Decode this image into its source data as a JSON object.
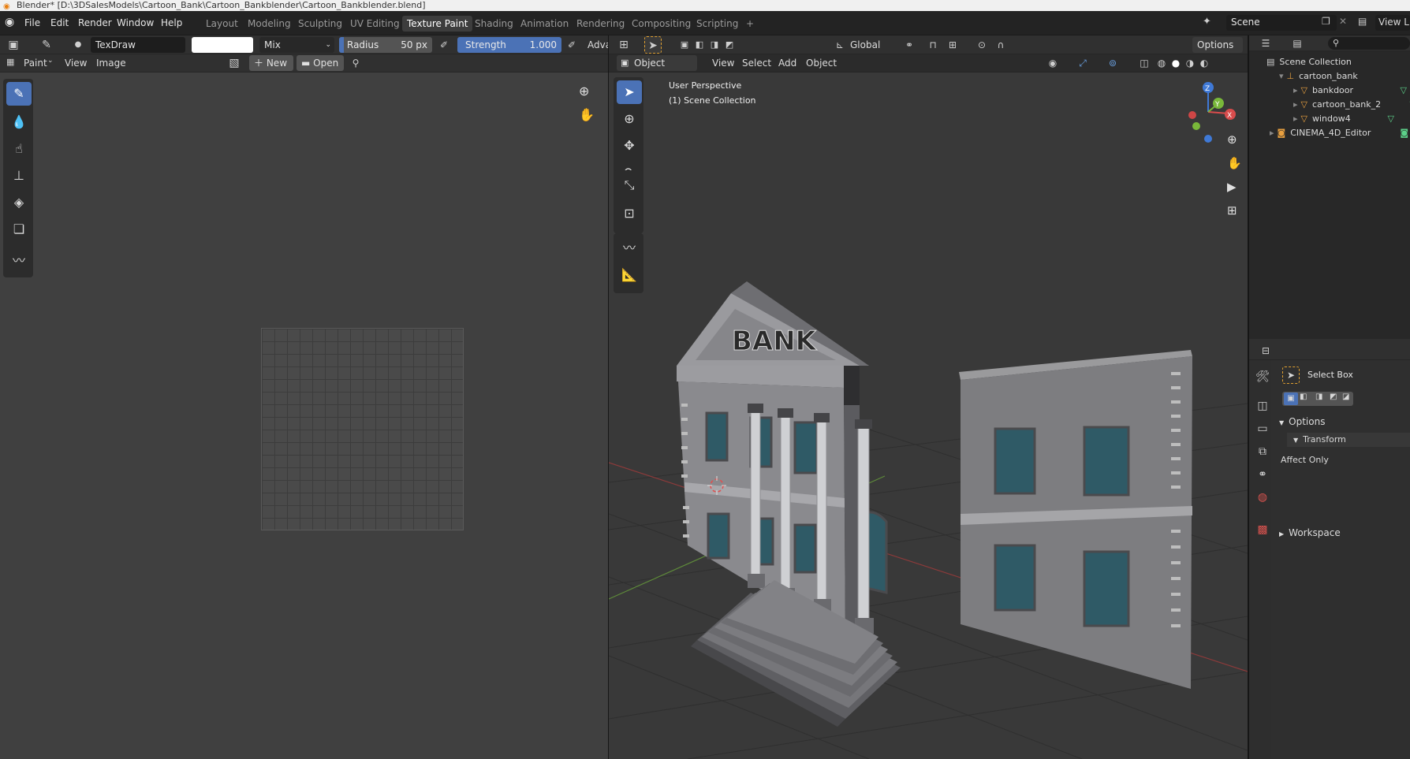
{
  "window_title": "Blender* [D:\\3DSalesModels\\Cartoon_Bank\\Cartoon_Bankblender\\Cartoon_Bankblender.blend]",
  "menu": [
    "File",
    "Edit",
    "Render",
    "Window",
    "Help"
  ],
  "workspaces": [
    "Layout",
    "Modeling",
    "Sculpting",
    "UV Editing",
    "Texture Paint",
    "Shading",
    "Animation",
    "Rendering",
    "Compositing",
    "Scripting"
  ],
  "active_workspace": "Texture Paint",
  "add_workspace": "+",
  "scene": "Scene",
  "view_layer": "View L",
  "image_editor": {
    "brush_name": "TexDraw",
    "blend_mode": "Mix",
    "radius_label": "Radius",
    "radius_value": "50 px",
    "strength_label": "Strength",
    "strength_value": "1.000",
    "advanced": "Adva",
    "mode": "Paint",
    "menus": [
      "View",
      "Image"
    ],
    "new_label": "New",
    "open_label": "Open"
  },
  "viewport": {
    "orientation": "Global",
    "options": "Options",
    "mode": "Object Mode",
    "menus": [
      "View",
      "Select",
      "Add",
      "Object"
    ],
    "perspective": "User Perspective",
    "collection": "(1) Scene Collection",
    "building_sign": "BANK",
    "gizmo_axes": {
      "z": "Z",
      "y": "Y",
      "x": "X"
    }
  },
  "outliner": {
    "root": "Scene Collection",
    "items": [
      {
        "name": "cartoon_bank",
        "depth": 1
      },
      {
        "name": "bankdoor",
        "depth": 2
      },
      {
        "name": "cartoon_bank_2",
        "depth": 2
      },
      {
        "name": "window4",
        "depth": 2
      },
      {
        "name": "CINEMA_4D_Editor",
        "depth": 1
      }
    ]
  },
  "properties": {
    "tool_name": "Select Box",
    "options": "Options",
    "transform": "Transform",
    "affect_only": "Affect Only",
    "workspace": "Workspace"
  },
  "colors": {
    "accent": "#4b72b6",
    "active_tool": "#4b72b6",
    "orange": "#e87d0d"
  }
}
